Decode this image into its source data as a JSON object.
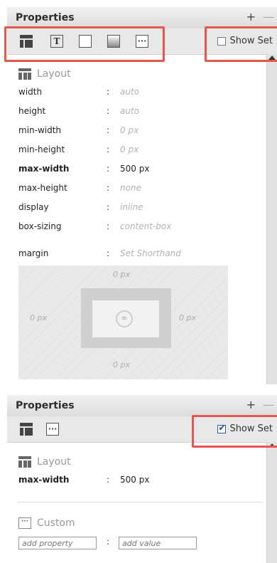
{
  "panel1": {
    "title": "Properties",
    "header_icons": {
      "add": "+",
      "minimize": "—"
    },
    "toolbar_icons": [
      "layout-icon",
      "text-icon",
      "box-icon",
      "background-icon",
      "custom-icon"
    ],
    "show_set": {
      "label": "Show Set",
      "checked": false
    },
    "section_title": "Layout",
    "properties": [
      {
        "name": "width",
        "value": "auto",
        "set": false
      },
      {
        "name": "height",
        "value": "auto",
        "set": false
      },
      {
        "name": "min-width",
        "value": "0 px",
        "set": false
      },
      {
        "name": "min-height",
        "value": "0 px",
        "set": false
      },
      {
        "name": "max-width",
        "value": "500 px",
        "set": true
      },
      {
        "name": "max-height",
        "value": "none",
        "set": false
      },
      {
        "name": "display",
        "value": "inline",
        "set": false
      },
      {
        "name": "box-sizing",
        "value": "content-box",
        "set": false
      }
    ],
    "margin": {
      "name": "margin",
      "value": "Set Shorthand"
    },
    "box_model": {
      "top": "0 px",
      "left": "0 px",
      "right": "0 px",
      "bottom": "0 px"
    }
  },
  "panel2": {
    "title": "Properties",
    "header_icons": {
      "add": "+",
      "minimize": "—"
    },
    "toolbar_icons": [
      "layout-icon",
      "custom-icon"
    ],
    "show_set": {
      "label": "Show Set",
      "checked": true
    },
    "section_title": "Layout",
    "properties": [
      {
        "name": "max-width",
        "value": "500 px",
        "set": true
      }
    ],
    "custom": {
      "title": "Custom",
      "property_placeholder": "add property",
      "value_placeholder": "add value",
      "colon": ":"
    }
  },
  "colors": {
    "highlight": "#e8554e",
    "checkbox": "#1f4f7a"
  }
}
